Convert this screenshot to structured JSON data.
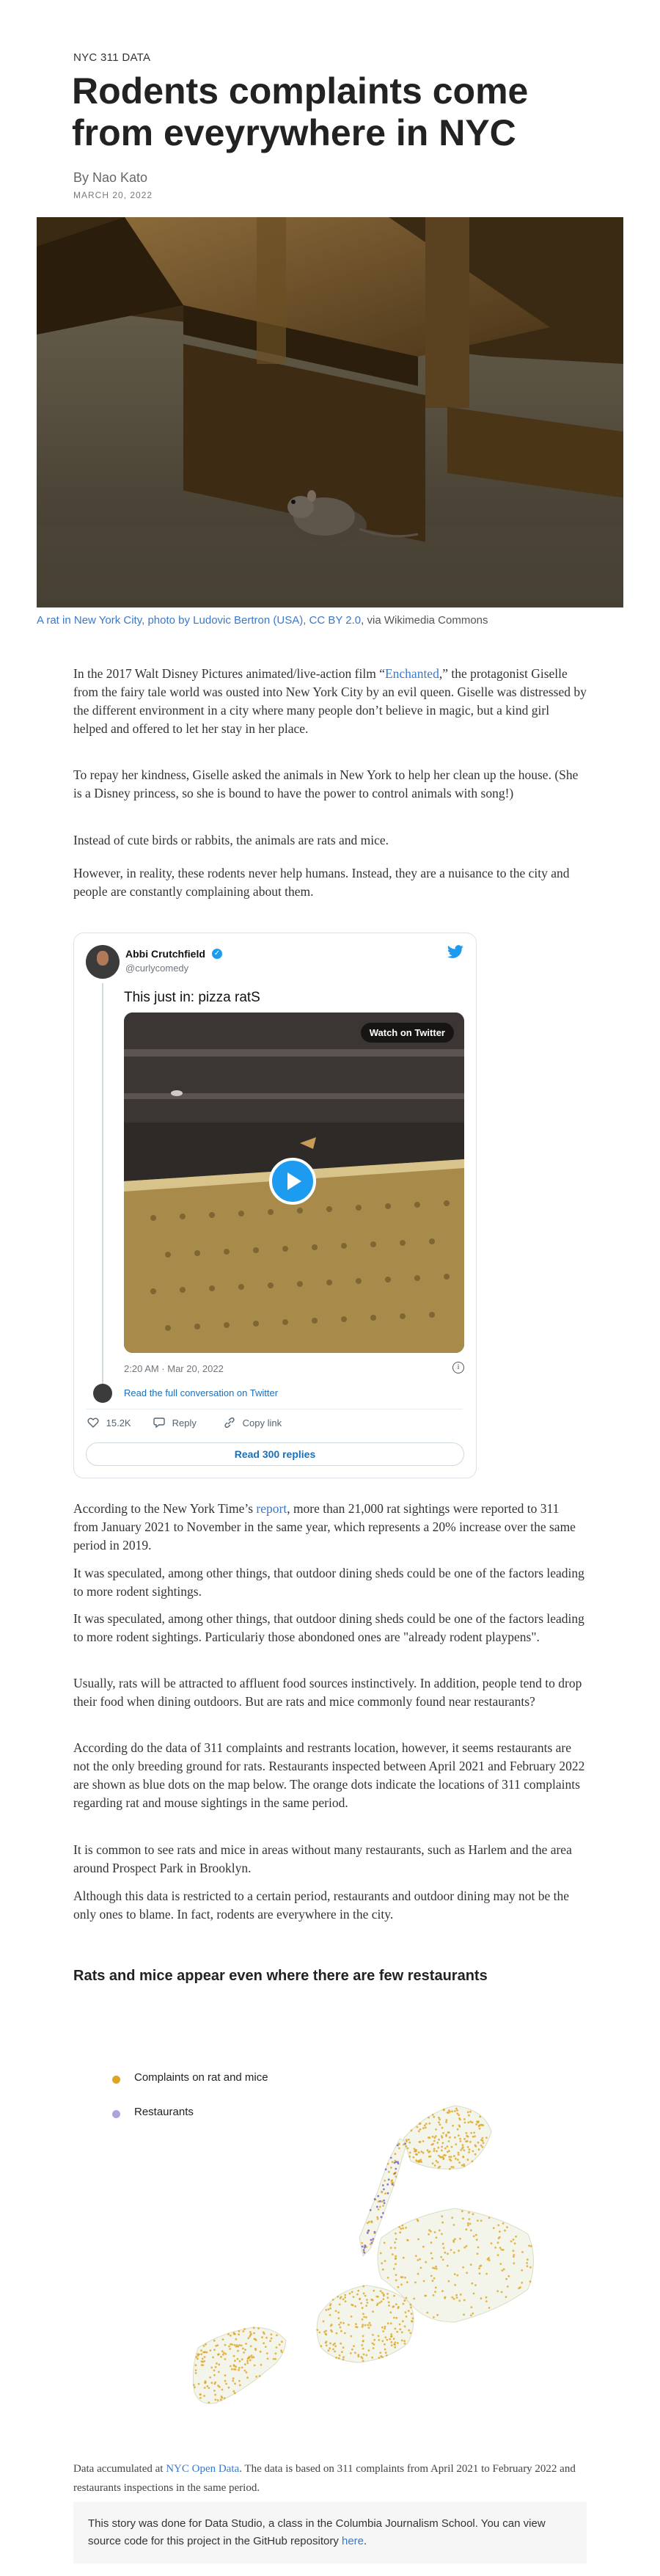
{
  "header": {
    "kicker": "NYC 311 DATA",
    "title": "Rodents complaints come from eveyrywhere in NYC",
    "byline": "By Nao Kato",
    "date": "MARCH 20, 2022"
  },
  "hero": {
    "caption_link": "A rat in New York City, photo by Ludovic Bertron (USA), CC BY 2.0",
    "caption_suffix": ", via Wikimedia Commons"
  },
  "intro": {
    "p1_before": "In the 2017 Walt Disney Pictures animated/live-action film “",
    "p1_link": "Enchanted",
    "p1_after": ",” the protagonist Giselle from the fairy tale world was ousted into New York City by an evil queen. Giselle was distressed by the different environment in a city where many people don’t believe in magic, but a kind girl helped and offered to let her stay in her place.",
    "p2": "To repay her kindness, Giselle asked the animals in New York to help her clean up the house. (She is a Disney princess, so she is bound to have the power to control animals with song!)",
    "p3": "Instead of cute birds or rabbits, the animals are rats and mice.",
    "p4": "However, in reality, these rodents never help humans. Instead, they are a nuisance to the city and people are constantly complaining about them."
  },
  "tweet": {
    "name": "Abbi Crutchfield",
    "handle": "@curlycomedy",
    "text": "This just in: pizza ratS",
    "watch_label": "Watch on Twitter",
    "meta": "2:20 AM · Mar 20, 2022",
    "read_full": "Read the full conversation on Twitter",
    "likes": "15.2K",
    "reply_label": "Reply",
    "copy_label": "Copy link",
    "replies_button": "Read 300 replies"
  },
  "body": {
    "p5_before": "According to the New York Time’s ",
    "p5_link": "report",
    "p5_after": ", more than 21,000 rat sightings were reported to 311 from January 2021 to November in the same year, which represents a 20% increase over the same period in 2019.",
    "p6": "It was speculated, among other things, that outdoor dining sheds could be one of the factors leading to more rodent sightings.",
    "p7": "It was speculated, among other things, that outdoor dining sheds could be one of the factors leading to more rodent sightings. Particulariy those abondoned ones are \"already rodent playpens\".",
    "p8": "Usually, rats will be attracted to affluent food sources instinctively. In addition, people tend to drop their food when dining outdoors. But are rats and mice commonly found near restaurants?",
    "p9": "According do the data of 311 complaints and restrants location, however, it seems restaurants are not the only breeding ground for rats. Restaurants inspected between April 2021 and February 2022 are shown as blue dots on the map below. The orange dots indicate the locations of 311 complaints regarding rat and mouse sightings in the same period.",
    "p10": "It is common to see rats and mice in areas without many restaurants, such as Harlem and the area around Prospect Park in Brooklyn.",
    "p11": "Although this data is restricted to a certain period, restaurants and outdoor dining may not be the only ones to blame. In fact, rodents are everywhere in the city."
  },
  "map_section": {
    "heading": "Rats and mice appear even where there are few restaurants",
    "legend_complaints": "Complaints on rat and mice",
    "legend_restaurants": "Restaurants",
    "complaint_color": "#e0a520",
    "restaurant_color": "#7a64c8"
  },
  "footer": {
    "note_before": "Data accumulated at ",
    "note_link": "NYC Open Data",
    "note_after": ". The data is based on 311 complaints from April 2021 to February 2022 and restaurants inspections in the same period.",
    "box_text": "This story was done for Data Studio, a class in the Columbia Journalism School. You can view source code for this project in the GitHub repository ",
    "box_link": "here",
    "box_end": "."
  }
}
